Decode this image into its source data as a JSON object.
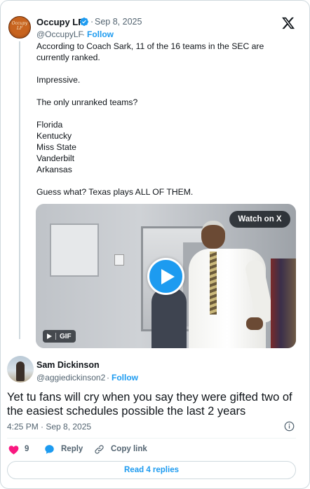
{
  "colors": {
    "accent": "#1d9bf0",
    "text_primary": "#0f1419",
    "text_secondary": "#536471",
    "like": "#f91880",
    "border": "#cfd9de"
  },
  "quoted_tweet": {
    "avatar_text": "Occupy LF",
    "display_name": "Occupy LF",
    "verified_icon": "verified-badge-icon",
    "separator": "·",
    "date": "Sep 8, 2025",
    "handle": "@OccupyLF",
    "follow_label": "Follow",
    "brand_icon": "x-logo-icon",
    "body": [
      "According to Coach Sark, 11 of the 16 teams in the SEC are currently ranked.",
      "Impressive.",
      "The only unranked teams?",
      "Florida\nKentucky\nMiss State\nVanderbilt\nArkansas",
      "Guess what? Texas plays ALL OF THEM."
    ],
    "media": {
      "watch_label": "Watch on X",
      "play_icon": "play-icon",
      "gif_label": "GIF"
    }
  },
  "reply_tweet": {
    "display_name": "Sam Dickinson",
    "handle": "@aggiedickinson2",
    "separator": "·",
    "follow_label": "Follow",
    "text": "Yet tu fans will cry when you say they were gifted two of the easiest schedules possible the last 2 years",
    "timestamp": "4:25 PM · Sep 8, 2025",
    "info_icon": "info-icon",
    "actions": {
      "like_count": "9",
      "reply_label": "Reply",
      "copy_link_label": "Copy link"
    },
    "read_replies_label": "Read 4 replies"
  }
}
